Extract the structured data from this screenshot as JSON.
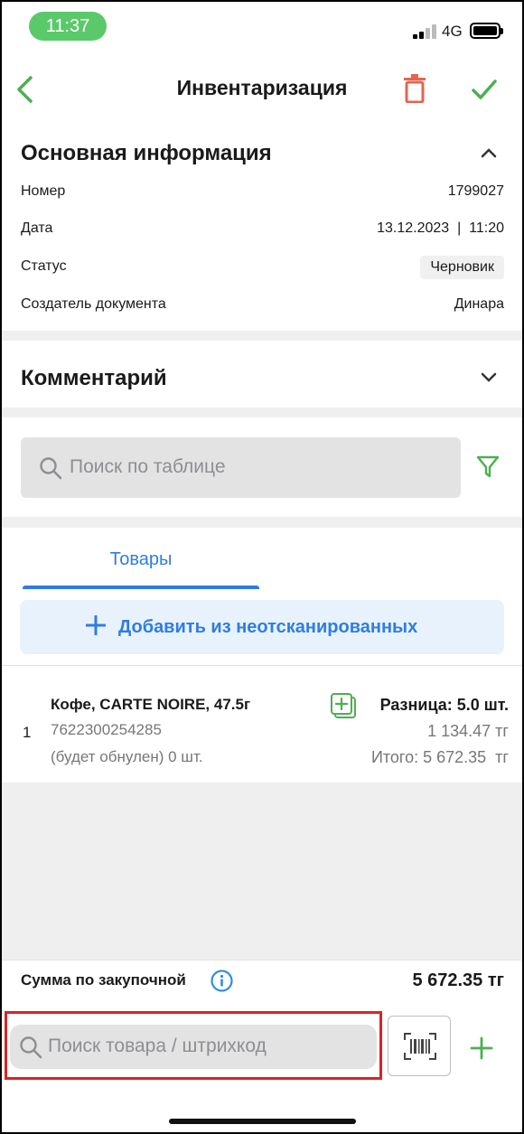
{
  "status_bar": {
    "time": "11:37",
    "network": "4G"
  },
  "header": {
    "title": "Инвентаризация"
  },
  "info": {
    "title": "Основная информация",
    "rows": [
      {
        "label": "Номер",
        "value": "1799027"
      },
      {
        "label": "Дата",
        "value": "13.12.2023  |  11:20"
      },
      {
        "label": "Статус",
        "value": "Черновик"
      },
      {
        "label": "Создатель документа",
        "value": "Динара"
      }
    ]
  },
  "comment": {
    "title": "Комментарий"
  },
  "table_search": {
    "placeholder": "Поиск по таблице"
  },
  "tabs": {
    "goods": "Товары"
  },
  "add_button": {
    "label": "Добавить из неотсканированных"
  },
  "products": [
    {
      "index": "1",
      "name": "Кофе, CARTE NOIRE, 47.5г",
      "barcode": "7622300254285",
      "reset_note": "(будет обнулен) 0 шт.",
      "difference": "Разница: 5.0 шт.",
      "price": "1 134.47 тг",
      "total": "Итого: 5 672.35  тг"
    }
  ],
  "summary": {
    "label": "Сумма по закупочной",
    "value": "5 672.35 тг"
  },
  "goods_search": {
    "placeholder": "Поиск товара / штрихкод"
  },
  "colors": {
    "accent_green": "#4caf50",
    "accent_blue": "#2f7de1",
    "danger": "#e5644e",
    "highlight": "#dd2222"
  }
}
